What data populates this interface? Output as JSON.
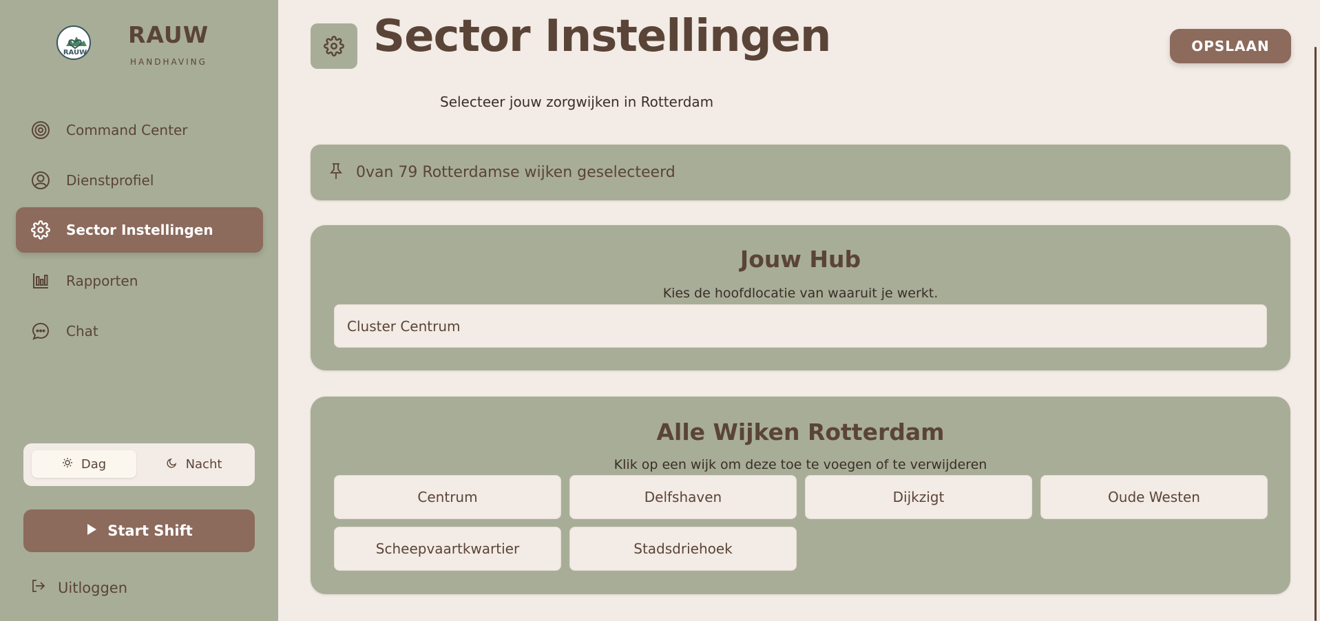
{
  "brand": {
    "name": "RAUW",
    "sub": "HANDHAVING",
    "logo_text": "RAUW"
  },
  "sidebar": {
    "items": [
      {
        "label": "Command Center",
        "icon": "target-icon"
      },
      {
        "label": "Dienstprofiel",
        "icon": "user-circle-icon"
      },
      {
        "label": "Sector Instellingen",
        "icon": "gear-icon",
        "active": true
      },
      {
        "label": "Rapporten",
        "icon": "bar-chart-icon"
      },
      {
        "label": "Chat",
        "icon": "chat-bubble-icon"
      }
    ],
    "theme": {
      "day": "Dag",
      "night": "Nacht",
      "selected": "Dag"
    },
    "start_shift": "Start Shift",
    "logout": "Uitloggen"
  },
  "header": {
    "title": "Sector Instellingen",
    "save_label": "OPSLAAN",
    "subtitle": "Selecteer jouw zorgwijken in Rotterdam"
  },
  "selection": {
    "text": "0van 79 Rotterdamse wijken geselecteerd"
  },
  "hub": {
    "title": "Jouw Hub",
    "description": "Kies de hoofdlocatie van waaruit je werkt.",
    "value": "Cluster Centrum"
  },
  "wijken": {
    "title": "Alle Wijken Rotterdam",
    "description": "Klik op een wijk om deze toe te voegen of te verwijderen",
    "items": [
      "Centrum",
      "Delfshaven",
      "Dijkzigt",
      "Oude Westen",
      "Scheepvaartkwartier",
      "Stadsdriehoek"
    ]
  },
  "colors": {
    "sidebar": "#a8ad97",
    "accent": "#8c6a5c",
    "background": "#f3ebe5",
    "text": "#5a4438"
  }
}
